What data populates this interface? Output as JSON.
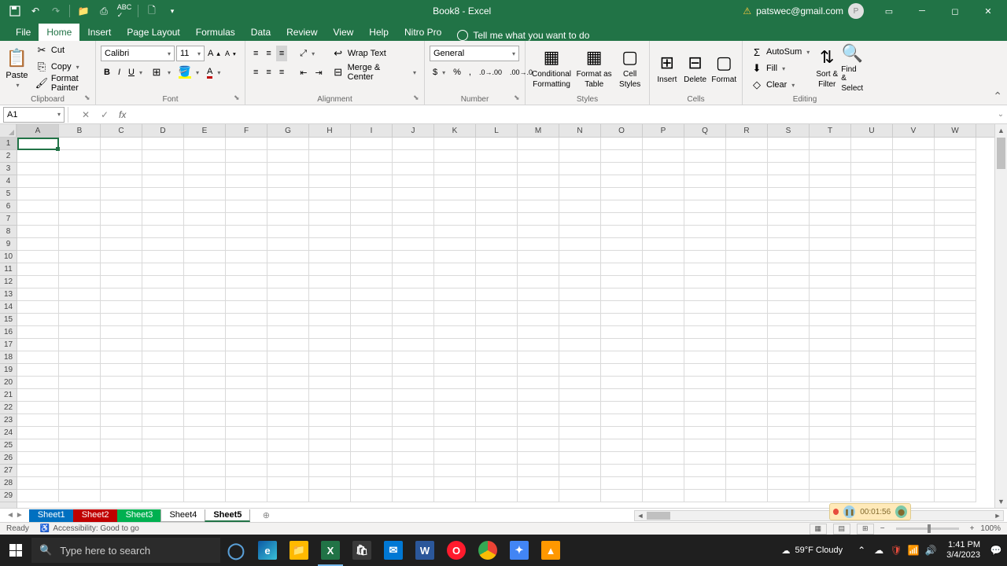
{
  "titlebar": {
    "doc_title": "Book8 - Excel",
    "user_email": "patswec@gmail.com",
    "user_initial": "P"
  },
  "ribbon_tabs": [
    "File",
    "Home",
    "Insert",
    "Page Layout",
    "Formulas",
    "Data",
    "Review",
    "View",
    "Help",
    "Nitro Pro"
  ],
  "active_tab": "Home",
  "tellme": "Tell me what you want to do",
  "ribbon": {
    "clipboard": {
      "label": "Clipboard",
      "paste": "Paste",
      "cut": "Cut",
      "copy": "Copy",
      "format_painter": "Format Painter"
    },
    "font": {
      "label": "Font",
      "name": "Calibri",
      "size": "11"
    },
    "alignment": {
      "label": "Alignment",
      "wrap": "Wrap Text",
      "merge": "Merge & Center"
    },
    "number": {
      "label": "Number",
      "format": "General"
    },
    "styles": {
      "label": "Styles",
      "cond": "Conditional",
      "cond2": "Formatting",
      "fat": "Format as",
      "fat2": "Table",
      "cell": "Cell",
      "cell2": "Styles"
    },
    "cells": {
      "label": "Cells",
      "insert": "Insert",
      "delete": "Delete",
      "format": "Format"
    },
    "editing": {
      "label": "Editing",
      "autosum": "AutoSum",
      "fill": "Fill",
      "clear": "Clear",
      "sort": "Sort &",
      "sort2": "Filter",
      "find": "Find &",
      "find2": "Select"
    }
  },
  "formula_bar": {
    "name_box": "A1",
    "formula": ""
  },
  "columns": [
    "A",
    "B",
    "C",
    "D",
    "E",
    "F",
    "G",
    "H",
    "I",
    "J",
    "K",
    "L",
    "M",
    "N",
    "O",
    "P",
    "Q",
    "R",
    "S",
    "T",
    "U",
    "V",
    "W"
  ],
  "rows": [
    "1",
    "2",
    "3",
    "4",
    "5",
    "6",
    "7",
    "8",
    "9",
    "10",
    "11",
    "12",
    "13",
    "14",
    "15",
    "16",
    "17",
    "18",
    "19",
    "20",
    "21",
    "22",
    "23",
    "24",
    "25",
    "26",
    "27",
    "28",
    "29"
  ],
  "sheets": [
    {
      "name": "Sheet1",
      "color": "blue"
    },
    {
      "name": "Sheet2",
      "color": "red"
    },
    {
      "name": "Sheet3",
      "color": "green"
    },
    {
      "name": "Sheet4",
      "color": ""
    },
    {
      "name": "Sheet5",
      "color": "active"
    }
  ],
  "recording": {
    "time": "00:01:56"
  },
  "status": {
    "ready": "Ready",
    "accessibility": "Accessibility: Good to go",
    "zoom": "100%"
  },
  "taskbar": {
    "search_placeholder": "Type here to search",
    "weather_temp": "59°F",
    "weather_cond": "Cloudy",
    "time": "1:41 PM",
    "date": "3/4/2023"
  }
}
